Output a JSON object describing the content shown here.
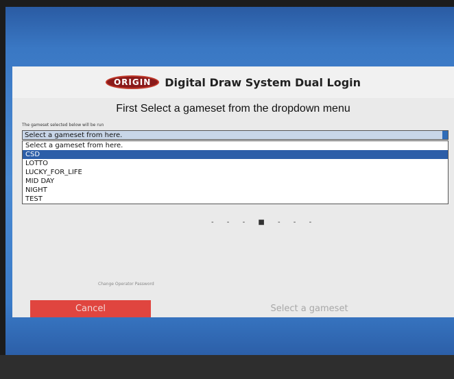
{
  "header": {
    "logo_text": "ORIGIN",
    "title": "Digital Draw System Dual Login"
  },
  "instruction": "First Select a gameset from the dropdown menu",
  "small_label": "The gameset selected below will be run",
  "dropdown": {
    "selected_value": "Select a gameset from here.",
    "options": [
      {
        "label": "Select a gameset from here.",
        "highlighted": false
      },
      {
        "label": "CSD",
        "highlighted": true
      },
      {
        "label": "LOTTO",
        "highlighted": false
      },
      {
        "label": "LUCKY_FOR_LIFE",
        "highlighted": false
      },
      {
        "label": "MID DAY",
        "highlighted": false
      },
      {
        "label": "NIGHT",
        "highlighted": false
      },
      {
        "label": "TEST",
        "highlighted": false
      }
    ]
  },
  "operator_link": "Change Operator Password",
  "buttons": {
    "cancel_label": "Cancel",
    "select_gameset_label": "Select a gameset"
  },
  "colors": {
    "cancel": "#e0453f",
    "highlight": "#2c5ea8",
    "desktop": "#3a78c4"
  }
}
